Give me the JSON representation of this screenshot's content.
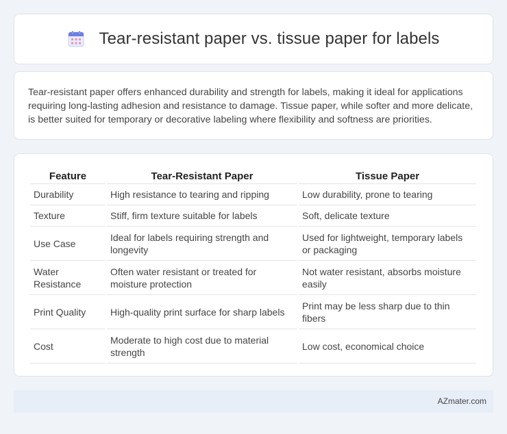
{
  "header": {
    "title": "Tear-resistant paper vs. tissue paper for labels",
    "icon": "calendar-icon"
  },
  "summary": {
    "text": "Tear-resistant paper offers enhanced durability and strength for labels, making it ideal for applications requiring long-lasting adhesion and resistance to damage. Tissue paper, while softer and more delicate, is better suited for temporary or decorative labeling where flexibility and softness are priorities."
  },
  "table": {
    "headers": [
      "Feature",
      "Tear-Resistant Paper",
      "Tissue Paper"
    ],
    "rows": [
      [
        "Durability",
        "High resistance to tearing and ripping",
        "Low durability, prone to tearing"
      ],
      [
        "Texture",
        "Stiff, firm texture suitable for labels",
        "Soft, delicate texture"
      ],
      [
        "Use Case",
        "Ideal for labels requiring strength and longevity",
        "Used for lightweight, temporary labels or packaging"
      ],
      [
        "Water Resistance",
        "Often water resistant or treated for moisture protection",
        "Not water resistant, absorbs moisture easily"
      ],
      [
        "Print Quality",
        "High-quality print surface for sharp labels",
        "Print may be less sharp due to thin fibers"
      ],
      [
        "Cost",
        "Moderate to high cost due to material strength",
        "Low cost, economical choice"
      ]
    ]
  },
  "footer": {
    "brand": "AZmater.com"
  },
  "colors": {
    "page_bg": "#f0f3f8",
    "card_bg": "#ffffff",
    "footer_bg": "#e8eef8",
    "icon_accent": "#6b7fe0"
  }
}
